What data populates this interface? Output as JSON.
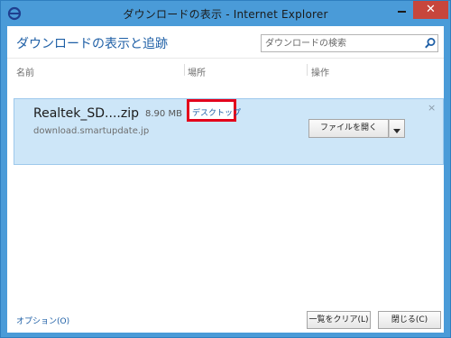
{
  "window": {
    "title": "ダウンロードの表示 - Internet Explorer",
    "close_glyph": "✕",
    "accent_color": "#4a9bd8"
  },
  "header": {
    "title": "ダウンロードの表示と追跡",
    "search_placeholder": "ダウンロードの検索",
    "search_icon": "search-icon"
  },
  "columns": {
    "name": "名前",
    "location": "場所",
    "action": "操作"
  },
  "downloads": [
    {
      "file_name": "Realtek_SD....zip",
      "size": "8.90 MB",
      "source": "download.smartupdate.jp",
      "location": "デスクトップ",
      "open_label": "ファイルを開く",
      "remove_glyph": "×"
    }
  ],
  "footer": {
    "options_label": "オプション(O)",
    "clear_label": "一覧をクリア(L)",
    "close_label": "閉じる(C)"
  },
  "highlight_color": "#e3001b"
}
